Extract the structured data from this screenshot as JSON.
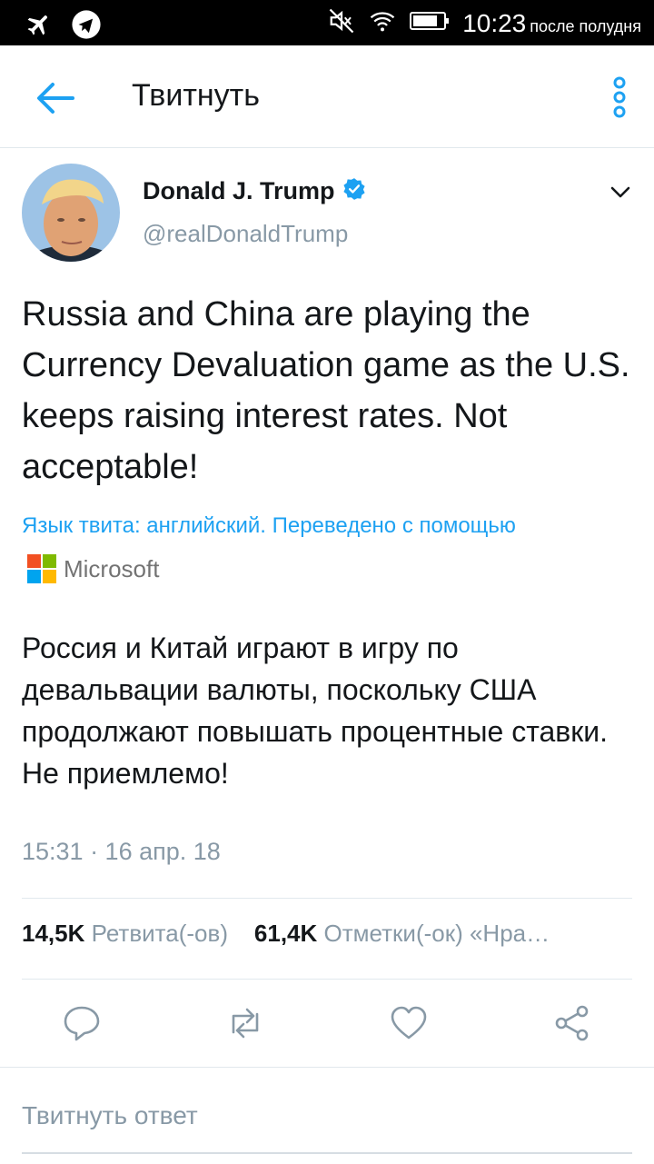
{
  "status_bar": {
    "time": "10:23",
    "time_suffix": "после полудня",
    "icons": [
      "airplane-mode-icon",
      "telegram-icon",
      "mute-icon",
      "wifi-icon",
      "battery-icon"
    ]
  },
  "app_bar": {
    "title": "Твитнуть",
    "accent": "#1da1f2"
  },
  "tweet": {
    "author_name": "Donald J. Trump",
    "verified": true,
    "handle": "@realDonaldTrump",
    "text": "Russia and China are playing the Currency Devaluation game as the U.S. keeps raising interest rates. Not acceptable!",
    "translation_note": "Язык твита: английский. Переведено с помощью",
    "translation_provider": "Microsoft",
    "translation_text": "Россия и Китай играют в игру по девальвации валюты, поскольку США продолжают повышать процентные ставки. Не приемлемо!",
    "timestamp": "15:31 · 16 апр. 18"
  },
  "stats": {
    "retweets_count": "14,5K",
    "retweets_label": "Ретвита(-ов)",
    "likes_count": "61,4K",
    "likes_label": "Отметки(-ок) «Нра…"
  },
  "actions": [
    "reply-icon",
    "retweet-icon",
    "like-icon",
    "share-icon"
  ],
  "reply": {
    "placeholder": "Твитнуть ответ"
  },
  "colors": {
    "accent": "#1da1f2",
    "secondary_text": "#8899a6",
    "primary_text": "#14171a",
    "divider": "#e1e8ed"
  }
}
